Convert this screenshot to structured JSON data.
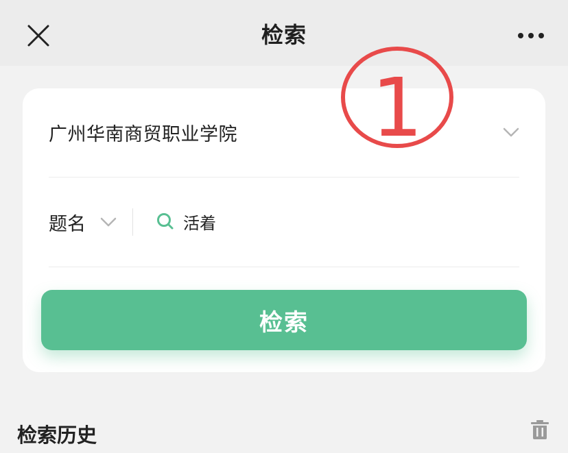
{
  "header": {
    "title": "检索",
    "close_icon": "close-icon",
    "more_icon": "more-horizontal-icon"
  },
  "search_card": {
    "school": "广州华南商贸职业学院",
    "field": "题名",
    "query": "活着",
    "search_button_label": "检索"
  },
  "history": {
    "title": "检索历史",
    "clear_icon": "trash-icon"
  },
  "annotation": {
    "label": "1",
    "color": "#e84a4a"
  },
  "colors": {
    "accent": "#58bf92",
    "annotation": "#e84a4a"
  }
}
